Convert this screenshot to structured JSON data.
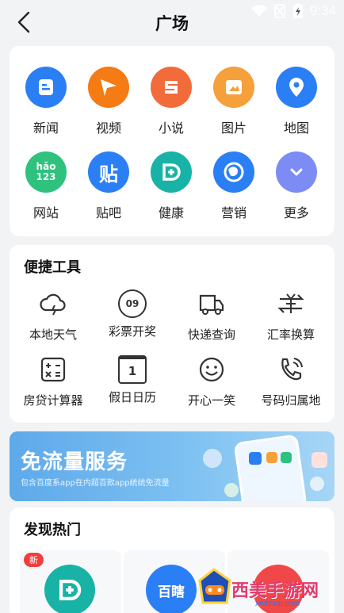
{
  "status_bar": {
    "time": "9:34"
  },
  "header": {
    "title": "广场"
  },
  "apps": [
    {
      "label": "新闻",
      "icon": "news-icon",
      "color": "#2b7ff5"
    },
    {
      "label": "视频",
      "icon": "video-play-icon",
      "color": "#f57b14"
    },
    {
      "label": "小说",
      "icon": "novel-icon",
      "color": "#f26b3a"
    },
    {
      "label": "图片",
      "icon": "image-icon",
      "color": "#f5a03a"
    },
    {
      "label": "地图",
      "icon": "map-pin-icon",
      "color": "#2b7ff5"
    },
    {
      "label": "网站",
      "icon": "hao123-icon",
      "color": "#2ec27e",
      "icon_text": "hǎo 123"
    },
    {
      "label": "贴吧",
      "icon": "tieba-icon",
      "color": "#2b7ff5",
      "icon_text": "贴"
    },
    {
      "label": "健康",
      "icon": "health-icon",
      "color": "#18b3a6"
    },
    {
      "label": "营销",
      "icon": "marketing-icon",
      "color": "#2b7ff5"
    },
    {
      "label": "更多",
      "icon": "chevron-down-icon",
      "color": "#7d8cf5"
    }
  ],
  "tools": {
    "title": "便捷工具",
    "items": [
      {
        "label": "本地天气",
        "icon": "weather-icon"
      },
      {
        "label": "彩票开奖",
        "icon": "lottery-icon",
        "icon_text": "09"
      },
      {
        "label": "快递查询",
        "icon": "delivery-truck-icon"
      },
      {
        "label": "汇率换算",
        "icon": "exchange-rate-icon"
      },
      {
        "label": "房贷计算器",
        "icon": "calculator-icon"
      },
      {
        "label": "假日日历",
        "icon": "calendar-icon",
        "icon_text": "1"
      },
      {
        "label": "开心一笑",
        "icon": "smile-icon"
      },
      {
        "label": "号码归属地",
        "icon": "phone-icon"
      }
    ]
  },
  "banner": {
    "title": "免流量服务",
    "subtitle": "包含百度系app在内超百款app统统免流量"
  },
  "discover": {
    "title": "发现热门",
    "badge": "新",
    "cards": [
      {
        "icon": "health-icon",
        "color": "#18b3a6"
      },
      {
        "icon": "baidu-app-icon",
        "color": "#2b7ff5",
        "icon_text": "百瞎"
      },
      {
        "icon": "red-app-icon",
        "color": "#f04848"
      }
    ]
  },
  "watermark": {
    "text": "西美手游网",
    "url": "xmfzxm.com"
  }
}
